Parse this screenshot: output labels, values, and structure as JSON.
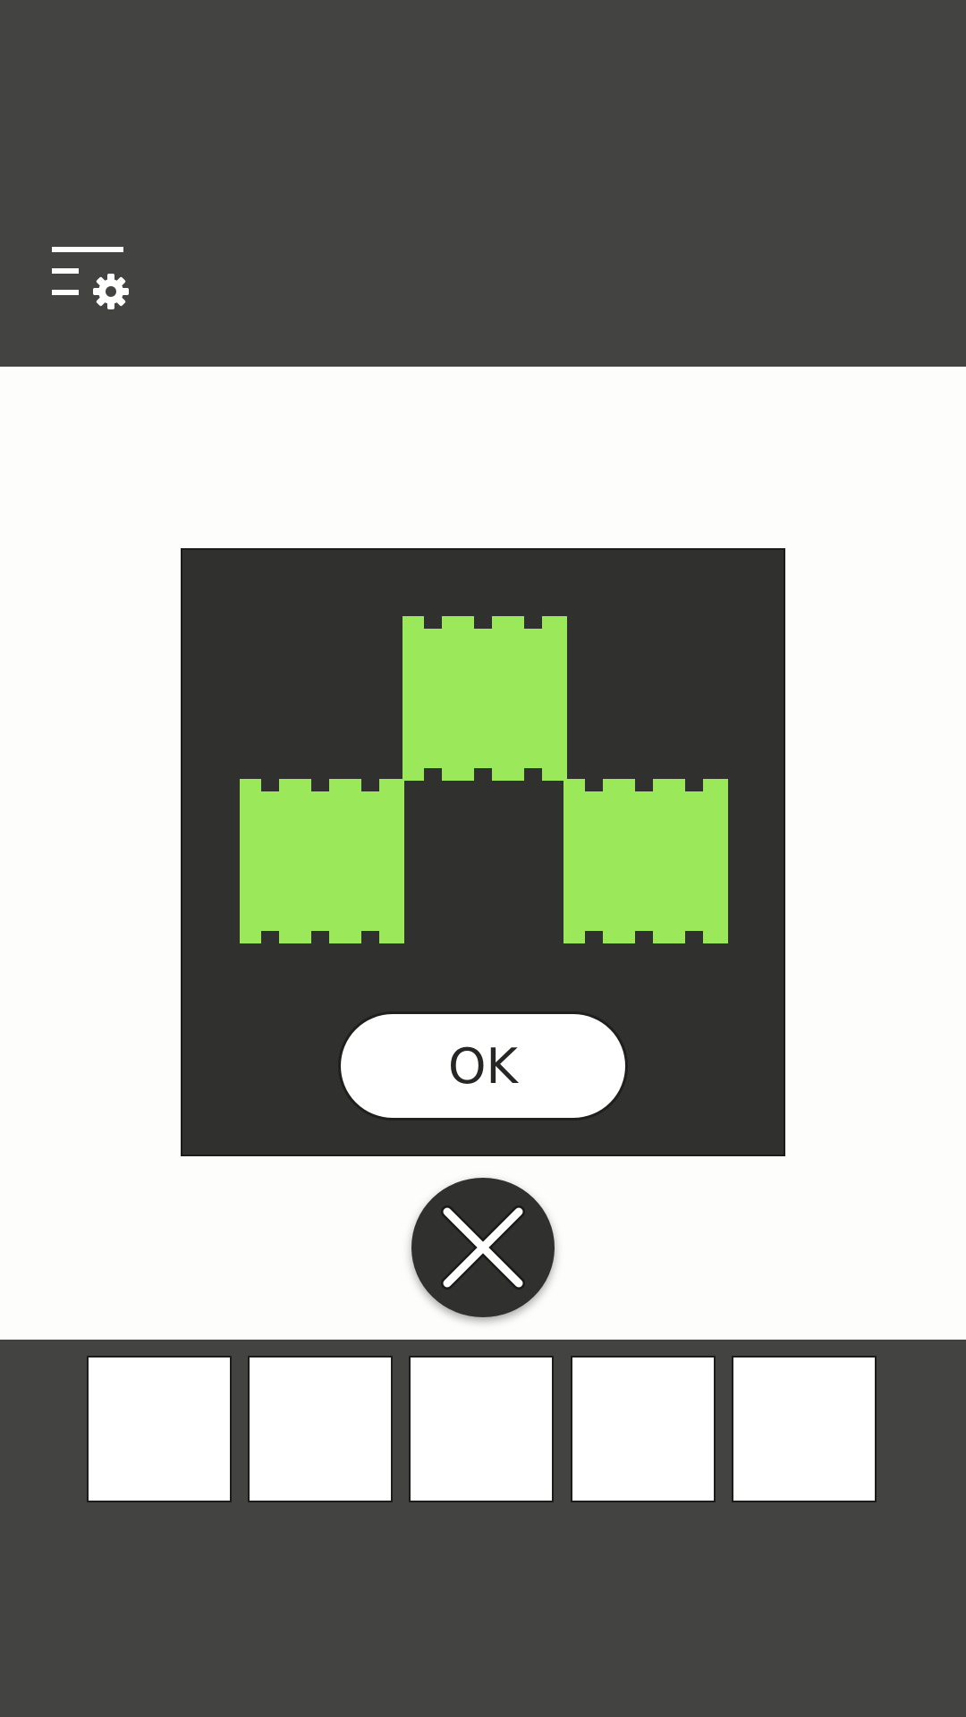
{
  "toolbar": {
    "menu_icon": "menu-settings-icon"
  },
  "puzzle": {
    "block_color": "#9be95a",
    "panel_color": "#30302e",
    "blocks": [
      {
        "name": "block-top-center"
      },
      {
        "name": "block-bottom-left"
      },
      {
        "name": "block-bottom-right"
      }
    ],
    "ok_label": "OK"
  },
  "close_button": {
    "icon": "close-icon"
  },
  "inventory": {
    "slots": [
      {
        "item": ""
      },
      {
        "item": ""
      },
      {
        "item": ""
      },
      {
        "item": ""
      },
      {
        "item": ""
      }
    ]
  }
}
